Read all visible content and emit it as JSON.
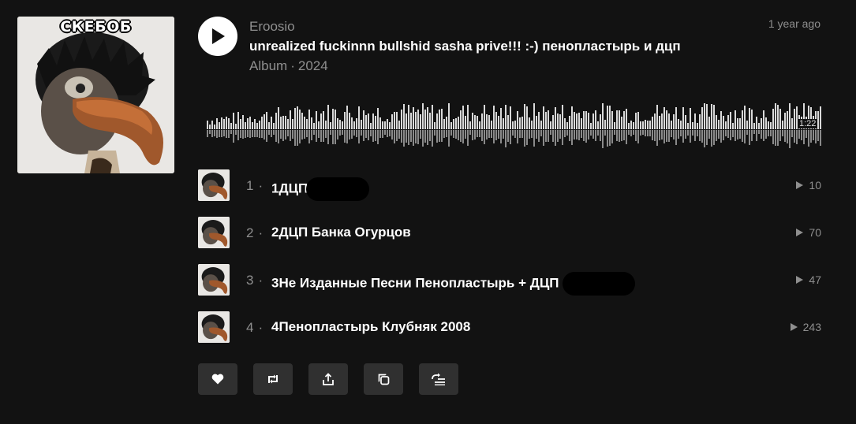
{
  "cover": {
    "caption": "СКЕБОБ"
  },
  "header": {
    "artist": "Eroosio",
    "title": "unrealized fuckinnn bullshid sasha prive!!! :-) пенопластырь и дцп",
    "type": "Album",
    "separator": "·",
    "year": "2024",
    "time_ago": "1 year ago",
    "duration": "1:22"
  },
  "tracks": [
    {
      "number": "1",
      "title": "1ДЦП",
      "plays": "10"
    },
    {
      "number": "2",
      "title": "2ДЦП Банка Огурцов",
      "plays": "70"
    },
    {
      "number": "3",
      "title": "3Не Изданные Песни Пенопластырь + ДЦП",
      "plays": "47"
    },
    {
      "number": "4",
      "title": "4Пенопластырь Клубняк 2008",
      "plays": "243"
    }
  ],
  "track_separator": "·",
  "actions": [
    "like-icon",
    "repost-icon",
    "share-icon",
    "copy-link-icon",
    "add-to-next-up-icon"
  ],
  "colors": {
    "background": "#121212",
    "muted_text": "#8f8f8f",
    "button_bg": "#303030"
  }
}
